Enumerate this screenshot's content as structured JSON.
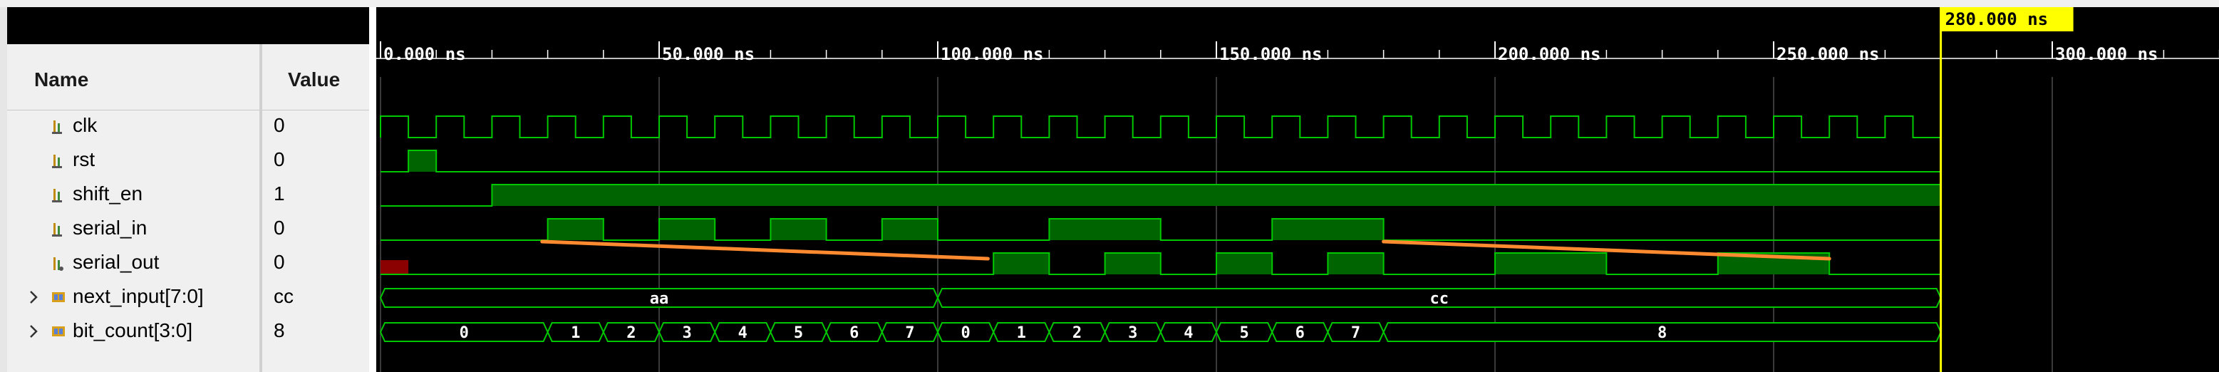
{
  "columns": {
    "name": "Name",
    "value": "Value"
  },
  "cursor": {
    "label": "280.000 ns",
    "time_ns": 280
  },
  "timeline": {
    "ticks": [
      {
        "t": 0,
        "label": "0.000 ns"
      },
      {
        "t": 50,
        "label": "50.000 ns"
      },
      {
        "t": 100,
        "label": "100.000 ns"
      },
      {
        "t": 150,
        "label": "150.000 ns"
      },
      {
        "t": 200,
        "label": "200.000 ns"
      },
      {
        "t": 250,
        "label": "250.000 ns"
      },
      {
        "t": 300,
        "label": "300.000 ns"
      }
    ]
  },
  "signals": [
    {
      "name": "clk",
      "value": "0",
      "type": "bit",
      "icon": "input-port-icon"
    },
    {
      "name": "rst",
      "value": "0",
      "type": "bit",
      "icon": "input-port-icon"
    },
    {
      "name": "shift_en",
      "value": "1",
      "type": "bit",
      "icon": "input-port-icon"
    },
    {
      "name": "serial_in",
      "value": "0",
      "type": "bit",
      "icon": "input-port-icon"
    },
    {
      "name": "serial_out",
      "value": "0",
      "type": "bit",
      "icon": "output-port-icon"
    },
    {
      "name": "next_input[7:0]",
      "value": "cc",
      "type": "bus",
      "icon": "bus-icon",
      "expandable": true
    },
    {
      "name": "bit_count[3:0]",
      "value": "8",
      "type": "bus",
      "icon": "bus-icon",
      "expandable": true
    }
  ],
  "waveforms": {
    "clk": {
      "period_ns": 10,
      "high_first": true
    },
    "rst": {
      "high": [
        [
          5,
          10
        ]
      ]
    },
    "shift_en": {
      "high": [
        [
          20,
          280
        ]
      ]
    },
    "serial_in": {
      "high": [
        [
          30,
          40
        ],
        [
          50,
          60
        ],
        [
          70,
          80
        ],
        [
          90,
          100
        ],
        [
          120,
          140
        ],
        [
          160,
          180
        ]
      ]
    },
    "serial_out": {
      "high": [
        [
          110,
          120
        ],
        [
          130,
          140
        ],
        [
          150,
          160
        ],
        [
          170,
          180
        ],
        [
          200,
          220
        ],
        [
          240,
          260
        ]
      ],
      "unknown": [
        [
          0,
          5
        ]
      ]
    },
    "next_input": {
      "segments": [
        {
          "start": 0,
          "end": 100,
          "label": "aa"
        },
        {
          "start": 100,
          "end": 280,
          "label": "cc"
        }
      ]
    },
    "bit_count": {
      "segments": [
        {
          "start": 0,
          "end": 30,
          "label": "0"
        },
        {
          "start": 30,
          "end": 40,
          "label": "1"
        },
        {
          "start": 40,
          "end": 50,
          "label": "2"
        },
        {
          "start": 50,
          "end": 60,
          "label": "3"
        },
        {
          "start": 60,
          "end": 70,
          "label": "4"
        },
        {
          "start": 70,
          "end": 80,
          "label": "5"
        },
        {
          "start": 80,
          "end": 90,
          "label": "6"
        },
        {
          "start": 90,
          "end": 100,
          "label": "7"
        },
        {
          "start": 100,
          "end": 110,
          "label": "0"
        },
        {
          "start": 110,
          "end": 120,
          "label": "1"
        },
        {
          "start": 120,
          "end": 130,
          "label": "2"
        },
        {
          "start": 130,
          "end": 140,
          "label": "3"
        },
        {
          "start": 140,
          "end": 150,
          "label": "4"
        },
        {
          "start": 150,
          "end": 160,
          "label": "5"
        },
        {
          "start": 160,
          "end": 170,
          "label": "6"
        },
        {
          "start": 170,
          "end": 180,
          "label": "7"
        },
        {
          "start": 180,
          "end": 280,
          "label": "8"
        }
      ]
    }
  },
  "annotations": [
    {
      "from_t": 29,
      "from_signal": "serial_in",
      "to_t": 109,
      "to_signal": "serial_out"
    },
    {
      "from_t": 180,
      "from_signal": "serial_in",
      "to_t": 260,
      "to_signal": "serial_out"
    }
  ],
  "colors": {
    "wave": "#00c800",
    "wave_fill": "#006400",
    "bus_fill": "#004a00",
    "unknown": "#8b0000",
    "cursor": "#ffff00",
    "grid": "#3a3a3a",
    "annotation": "#ff8a30"
  }
}
